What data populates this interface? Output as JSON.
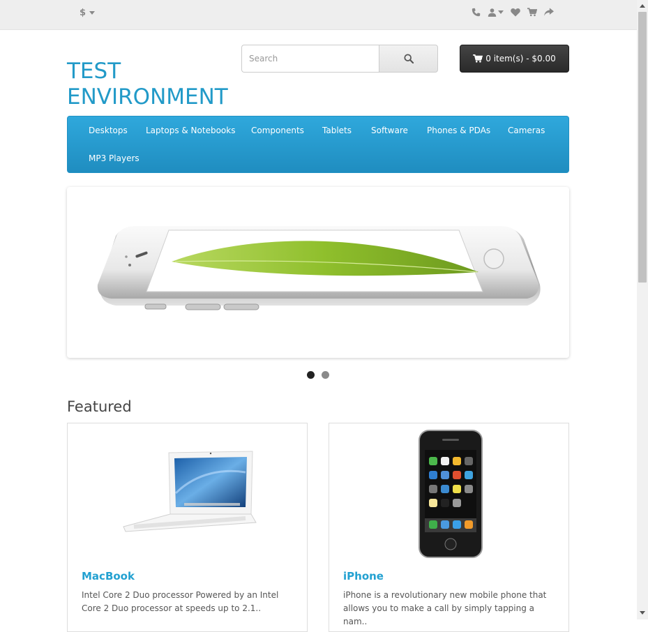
{
  "topbar": {
    "currency_symbol": "$",
    "icons": [
      "phone-icon",
      "user-icon",
      "heart-icon",
      "cart-icon",
      "share-icon"
    ]
  },
  "logo": {
    "line1": "TEST",
    "line2": "ENVIRONMENT",
    "color": "#229ac8"
  },
  "search": {
    "placeholder": "Search",
    "icon": "search-icon"
  },
  "cart": {
    "label": "0 item(s) - $0.00",
    "icon": "cart-icon"
  },
  "menu": {
    "items": [
      "Desktops",
      "Laptops & Notebooks",
      "Components",
      "Tablets",
      "Software",
      "Phones & PDAs",
      "Cameras",
      "MP3 Players"
    ]
  },
  "slideshow": {
    "slide_count": 2,
    "active_index": 0
  },
  "featured": {
    "title": "Featured",
    "products": [
      {
        "name": "MacBook",
        "description": "Intel Core 2 Duo processor Powered by an Intel Core 2 Duo processor at speeds up to 2.1.."
      },
      {
        "name": "iPhone",
        "description": "iPhone is a revolutionary new mobile phone that allows you to make a call by simply tapping a nam.."
      }
    ]
  },
  "colors": {
    "accent": "#229ac8",
    "menu": "#229ac8",
    "cart_bg": "#363636",
    "link": "#23a1d1"
  }
}
